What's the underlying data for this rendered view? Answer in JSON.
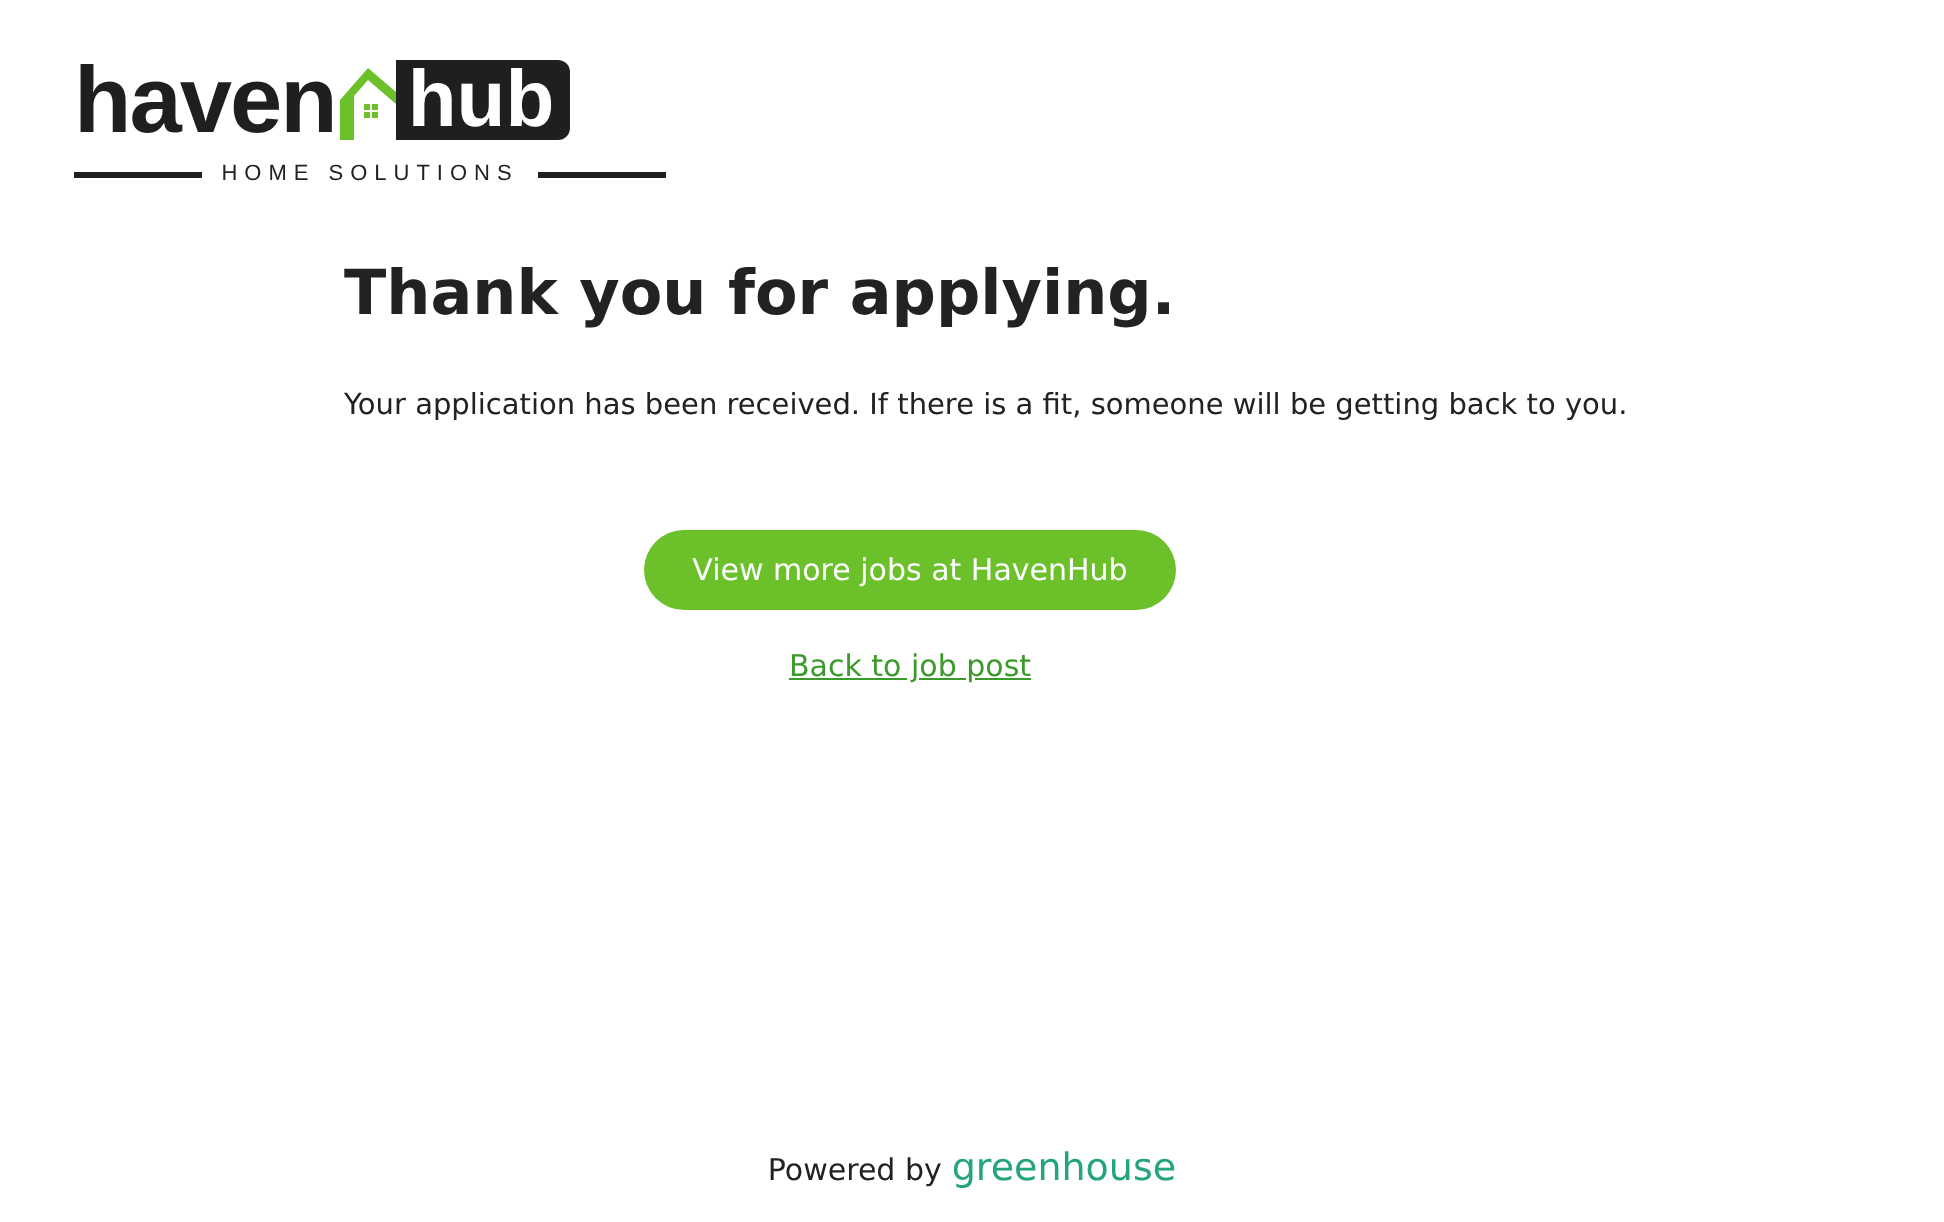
{
  "logo": {
    "word_1": "haven",
    "word_2": "hub",
    "tagline": "HOME SOLUTIONS"
  },
  "heading": "Thank you for applying.",
  "message": "Your application has been received. If there is a fit, someone will be getting back to you.",
  "primary_button": "View more jobs at HavenHub",
  "back_link": "Back to job post",
  "footer": {
    "text": "Powered by",
    "brand": "greenhouse"
  }
}
